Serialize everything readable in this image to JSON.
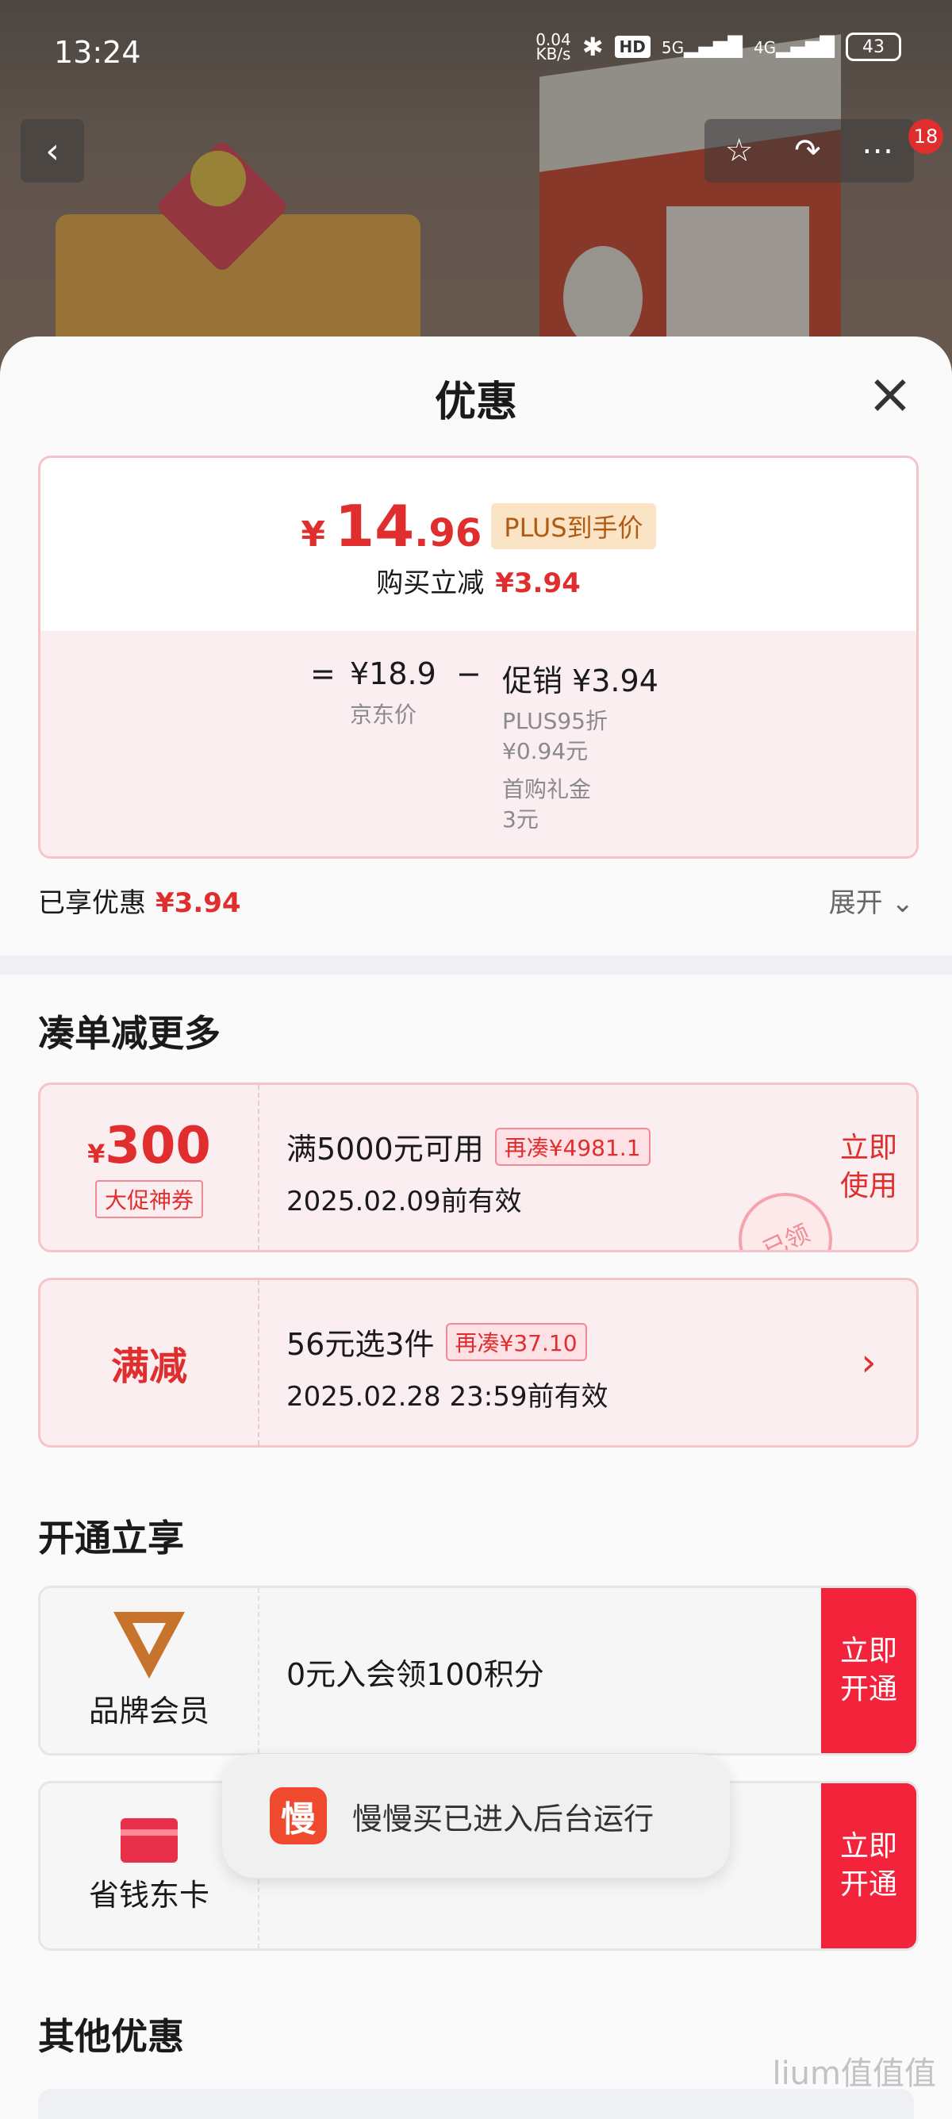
{
  "status": {
    "time": "13:24",
    "net_speed": "0.04\nKB/s",
    "hd": "HD",
    "sig5g": "5G",
    "sig4g": "4G",
    "battery": "43"
  },
  "nav": {
    "badge": "18"
  },
  "sheet": {
    "title": "优惠"
  },
  "price": {
    "yen": "¥",
    "int": "14",
    "dec": ".96",
    "plus_tag": "PLUS到手价",
    "cut_label": "购买立减",
    "cut_value": "¥3.94",
    "eq": "=",
    "jd_value": "¥18.9",
    "jd_label": "京东价",
    "minus": "−",
    "promo_label": "促销 ¥3.94",
    "promo_lines": [
      "PLUS95折",
      "¥0.94元",
      "首购礼金",
      "3元"
    ]
  },
  "enjoyed": {
    "label": "已享优惠",
    "value": "¥3.94",
    "expand": "展开"
  },
  "section1": {
    "title": "凑单减更多"
  },
  "coupon1": {
    "yen": "¥",
    "amount": "300",
    "tag": "大促神券",
    "line1": "满5000元可用",
    "extra": "再凑¥4981.1",
    "line2": "2025.02.09前有效",
    "action1": "立即",
    "action2": "使用",
    "stamp": "已领"
  },
  "coupon2": {
    "left": "满减",
    "line1": "56元选3件",
    "extra": "再凑¥37.10",
    "line2": "2025.02.28 23:59前有效",
    "arrow": "›"
  },
  "section2": {
    "title": "开通立享"
  },
  "member1": {
    "label": "品牌会员",
    "desc": "0元入会领100积分",
    "action1": "立即",
    "action2": "开通"
  },
  "member2": {
    "label": "省钱东卡",
    "desc": "",
    "action1": "立即",
    "action2": "开通"
  },
  "toast": {
    "icon": "慢",
    "text": "慢慢买已进入后台运行"
  },
  "section3": {
    "title": "其他优惠"
  },
  "watermark": "lium值值值"
}
